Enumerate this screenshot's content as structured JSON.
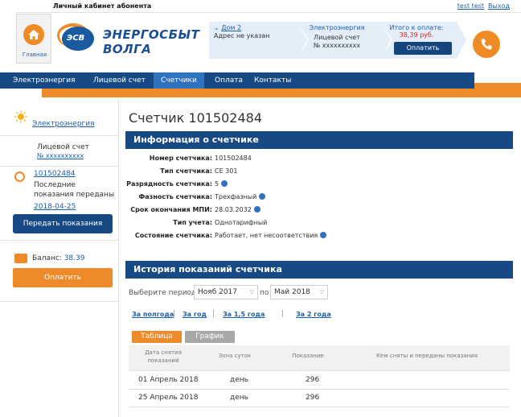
{
  "topbar": {
    "title": "Личный кабинет абонента",
    "user": "test test",
    "exit": "Выход"
  },
  "header": {
    "home_label": "Главная",
    "logo_badge": "ЭСВ",
    "logo_line1": "ЭНЕРГОСБЫТ",
    "logo_line2": "ВОЛГА",
    "house_link": "Дом 2",
    "address": "Адрес не указан",
    "service": "Электроэнергия",
    "account_label": "Лицевой счет",
    "account_number": "№ xxxxxxxxxx",
    "total_label": "Итого к оплате:",
    "total_amount": "38,39 руб.",
    "pay_button": "Оплатить"
  },
  "nav": {
    "items": [
      "Электроэнергия",
      "Лицевой счет",
      "Счетчики",
      "Оплата",
      "Контакты"
    ],
    "active": "Счетчики"
  },
  "sidebar": {
    "service_link": "Электроэнергия",
    "account_label": "Лицевой счет",
    "account_number": "№ xxxxxxxxxx",
    "meter_number": "101502484",
    "last_readings_line1": "Последние",
    "last_readings_line2": "показания переданы",
    "last_date": "2018-04-25",
    "send_button": "Передать показания",
    "balance_label": "Баланс:",
    "balance_value": "38.39",
    "pay_button": "Оплатить"
  },
  "main": {
    "title": "Счетчик 101502484",
    "info_header": "Информация о счетчике",
    "info": [
      {
        "label": "Номер счетчика:",
        "value": "101502484",
        "help": false
      },
      {
        "label": "Тип счетчика:",
        "value": "CE 301",
        "help": false
      },
      {
        "label": "Разрядность счетчика:",
        "value": "5",
        "help": true
      },
      {
        "label": "Фазность счетчика:",
        "value": "Трехфазный",
        "help": true
      },
      {
        "label": "Срок окончания МПИ:",
        "value": "28.03.2032",
        "help": true
      },
      {
        "label": "Тип учета:",
        "value": "Однотарифный",
        "help": false
      },
      {
        "label": "Состояние счетчика:",
        "value": "Работает, нет несоответствия",
        "help": true
      }
    ],
    "history_header": "История показаний счетчика",
    "period_label": "Выберите период с",
    "period_from": "Нояб 2017",
    "period_to_label": "по",
    "period_to": "Май 2018",
    "quick_ranges": [
      "За полгода",
      "За год",
      "За 1,5 года",
      "За 2 года"
    ],
    "tabs": [
      "Таблица",
      "График"
    ],
    "columns": [
      "Дата снятия показаний",
      "Зона суток",
      "Показание",
      "Кем сняты и переданы показания"
    ],
    "rows": [
      {
        "date": "01 Апрель 2018",
        "zone": "день",
        "value": "296",
        "by": ""
      },
      {
        "date": "25 Апрель 2018",
        "zone": "день",
        "value": "296",
        "by": ""
      }
    ]
  },
  "colors": {
    "nav_blue": "#174a85",
    "accent_orange": "#ef8a2a",
    "link_blue": "#1d5fa8",
    "amount_red": "#d42a2a"
  }
}
